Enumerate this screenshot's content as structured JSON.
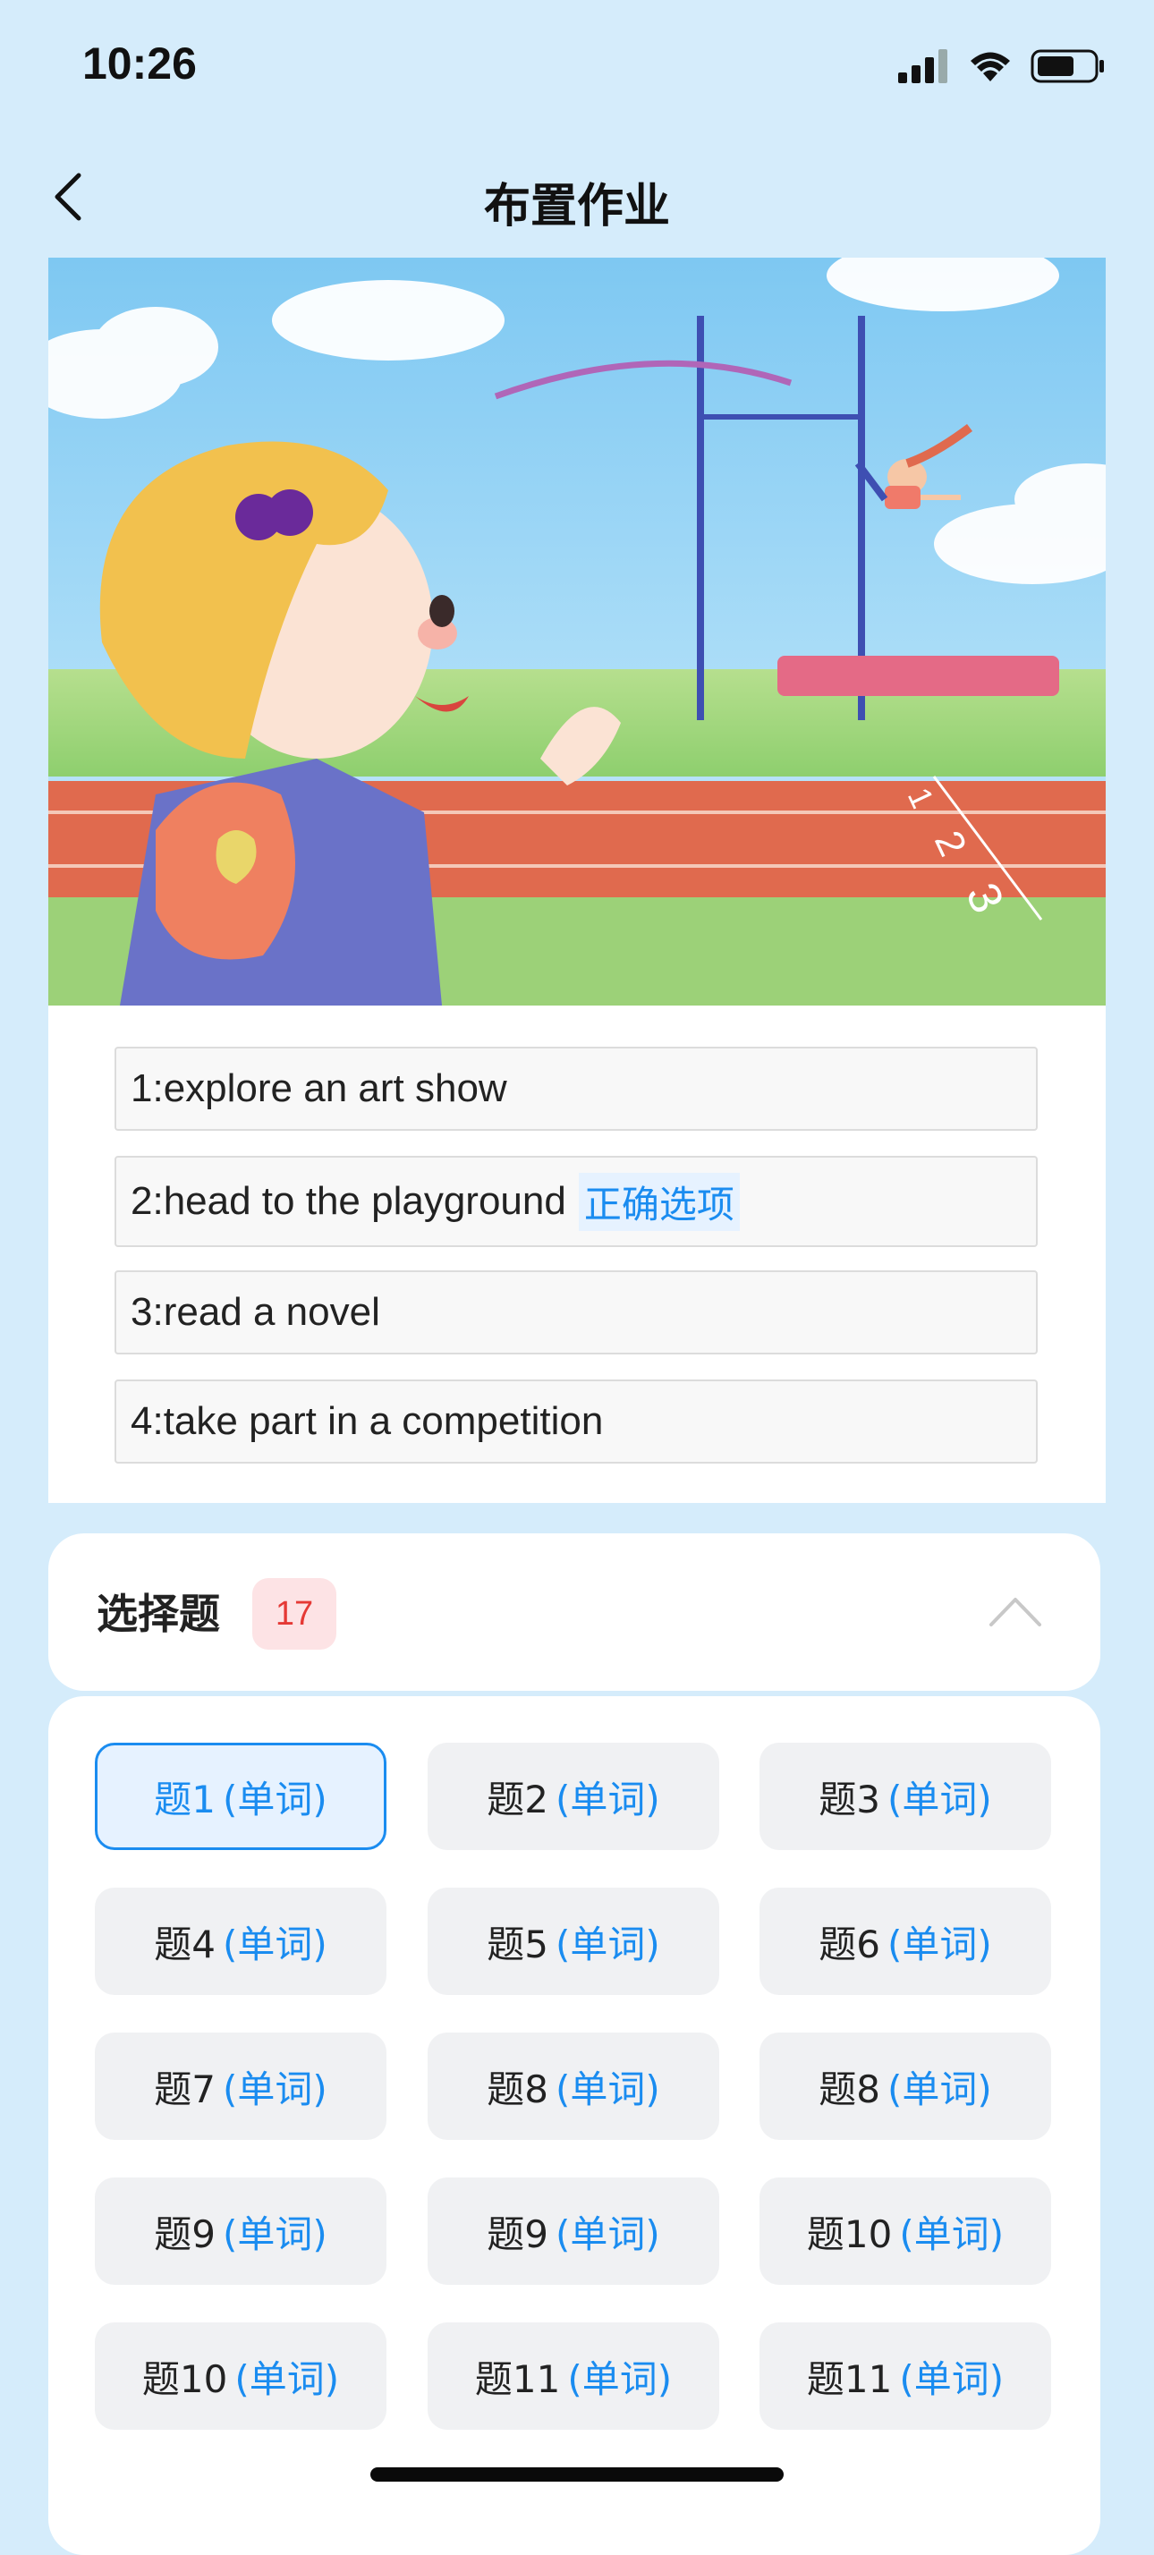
{
  "status": {
    "time": "10:26"
  },
  "nav": {
    "title": "布置作业"
  },
  "hero": {
    "track_numbers": [
      "1",
      "2",
      "3"
    ]
  },
  "options": [
    {
      "text": "1:explore an art show",
      "tag": ""
    },
    {
      "text": "2:head to the playground",
      "tag": "正确选项"
    },
    {
      "text": "3:read a novel",
      "tag": ""
    },
    {
      "text": "4:take part in a competition",
      "tag": ""
    }
  ],
  "section": {
    "title": "选择题",
    "count": "17"
  },
  "questions": [
    {
      "label": "题1",
      "type": "(单词)"
    },
    {
      "label": "题2",
      "type": "(单词)"
    },
    {
      "label": "题3",
      "type": "(单词)"
    },
    {
      "label": "题4",
      "type": "(单词)"
    },
    {
      "label": "题5",
      "type": "(单词)"
    },
    {
      "label": "题6",
      "type": "(单词)"
    },
    {
      "label": "题7",
      "type": "(单词)"
    },
    {
      "label": "题8",
      "type": "(单词)"
    },
    {
      "label": "题8",
      "type": "(单词)"
    },
    {
      "label": "题9",
      "type": "(单词)"
    },
    {
      "label": "题9",
      "type": "(单词)"
    },
    {
      "label": "题10",
      "type": "(单词)"
    },
    {
      "label": "题10",
      "type": "(单词)"
    },
    {
      "label": "题11",
      "type": "(单词)"
    },
    {
      "label": "题11",
      "type": "(单词)"
    }
  ],
  "colors": {
    "accent": "#1a8cf0",
    "badge_bg": "#fde3e5",
    "badge_text": "#e53935",
    "page_bg": "#d5ecfb"
  }
}
